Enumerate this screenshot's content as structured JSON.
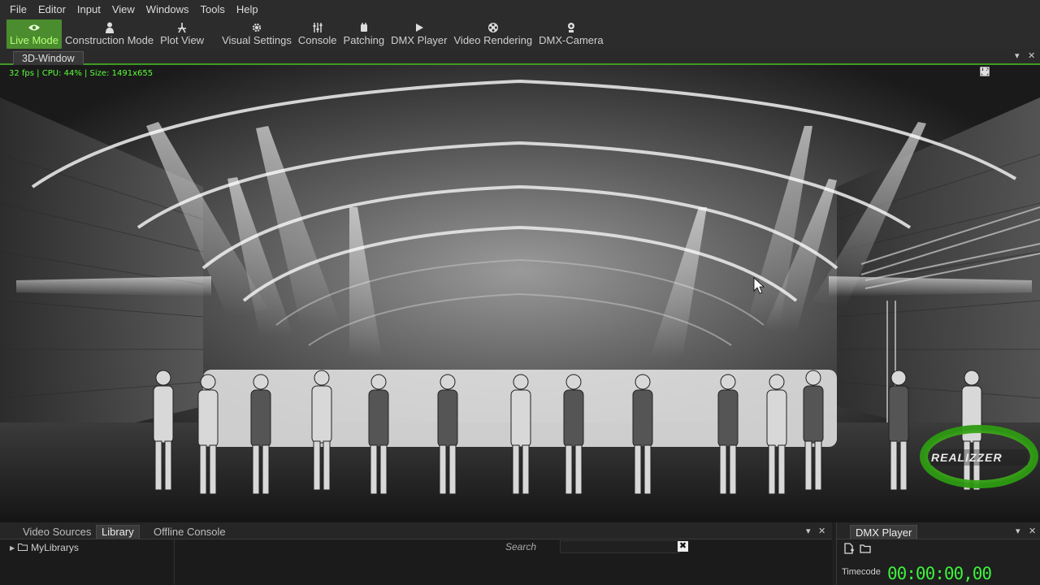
{
  "menu": [
    "File",
    "Editor",
    "Input",
    "View",
    "Windows",
    "Tools",
    "Help"
  ],
  "toolbar": {
    "live_mode": "Live Mode",
    "construction_mode": "Construction Mode",
    "plot_view": "Plot View",
    "visual_settings": "Visual Settings",
    "console": "Console",
    "patching": "Patching",
    "dmx_player": "DMX Player",
    "video_rendering": "Video Rendering",
    "dmx_camera": "DMX-Camera"
  },
  "window": {
    "tab_label": "3D-Window",
    "stats": "32 fps | CPU: 44% | Size: 1491x655"
  },
  "bottom": {
    "tabs": [
      "Video Sources",
      "Library",
      "Offline Console"
    ],
    "active_tab": "Library",
    "tree_item": "MyLibrarys",
    "search_label": "Search",
    "search_value": "",
    "search_clear": "✖"
  },
  "dmx_player": {
    "tab_label": "DMX Player",
    "timecode_label": "Timecode",
    "timecode_value": "00:00:00,00"
  },
  "watermark": "REALIZZER",
  "colors": {
    "accent": "#4a8c2e",
    "accent_text": "#b6ff7a",
    "stats_text": "#5cff3a",
    "timecode": "#3cf23c"
  },
  "icons": {
    "live_mode": "eye-icon",
    "construction_mode": "person-icon",
    "plot_view": "plot-icon",
    "visual_settings": "gear-icon",
    "console": "faders-icon",
    "patching": "patch-icon",
    "dmx_player": "play-icon",
    "video_rendering": "film-reel-icon",
    "dmx_camera": "camera-icon"
  }
}
